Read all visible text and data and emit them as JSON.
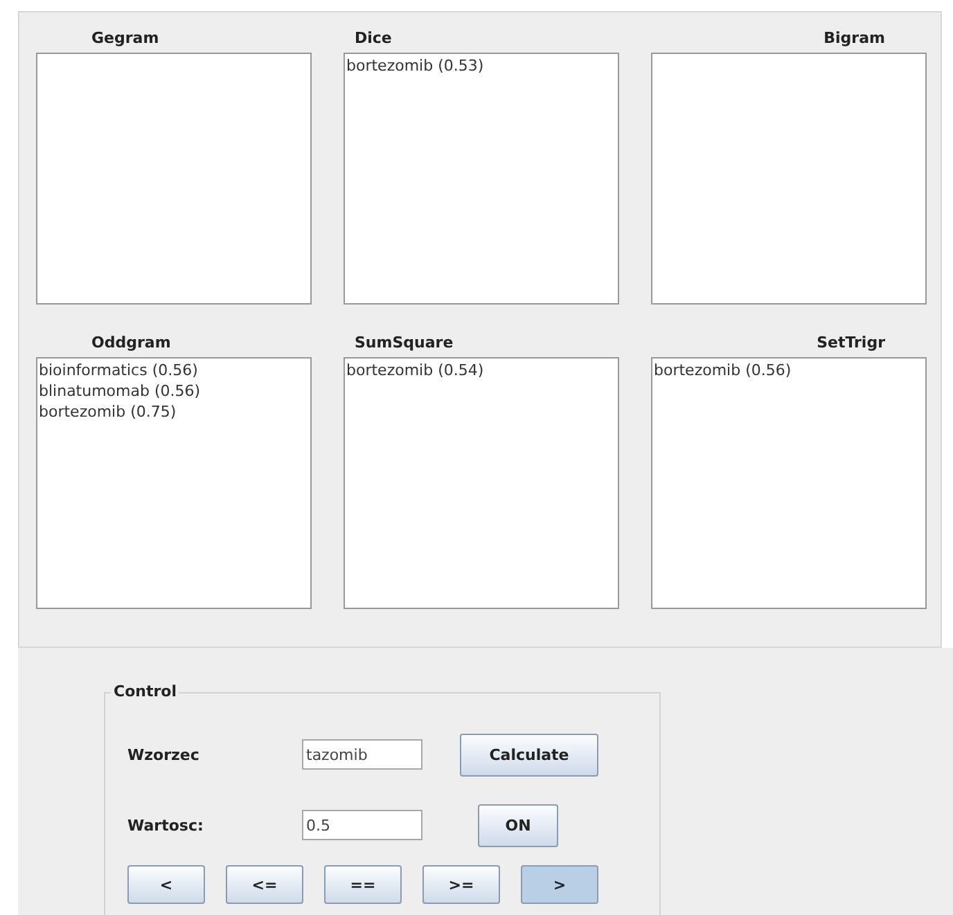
{
  "lists": [
    {
      "title": "Gegram"
    },
    {
      "title": "Dice",
      "items": [
        "bortezomib (0.53)"
      ]
    },
    {
      "title": "Bigram"
    },
    {
      "title": "Oddgram",
      "items": [
        "bioinformatics (0.56)",
        "blinatumomab (0.56)",
        "bortezomib (0.75)"
      ]
    },
    {
      "title": "SumSquare",
      "items": [
        "bortezomib (0.54)"
      ]
    },
    {
      "title": "SetTrigr",
      "items": [
        "bortezomib (0.56)"
      ]
    }
  ],
  "control": {
    "legend": "Control",
    "pattern": {
      "label": "Wzorzec",
      "value": "tazomib"
    },
    "calculate": "Calculate",
    "threshold": {
      "label": "Wartosc:",
      "value": "0.5"
    },
    "toggle": "ON",
    "comparators": [
      {
        "label": "<",
        "selected": false
      },
      {
        "label": "<=",
        "selected": false
      },
      {
        "label": "==",
        "selected": false
      },
      {
        "label": ">=",
        "selected": false
      },
      {
        "label": ">",
        "selected": true
      }
    ]
  }
}
